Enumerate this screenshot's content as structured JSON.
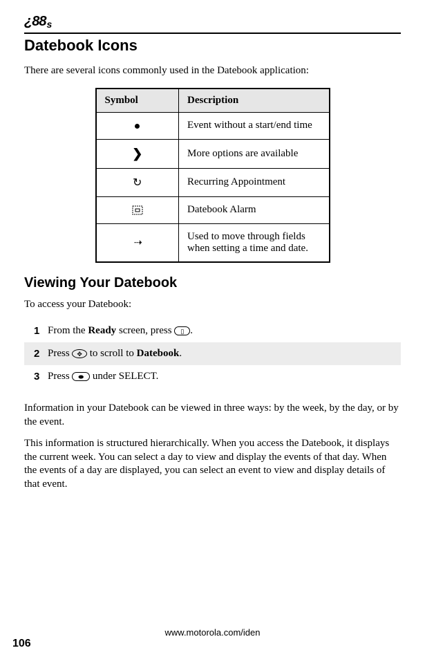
{
  "brand": "¿88",
  "brand_suffix": "s",
  "h1": "Datebook Icons",
  "intro": "There are several icons commonly used in the Datebook application:",
  "table": {
    "header_symbol": "Symbol",
    "header_desc": "Description",
    "rows": [
      {
        "desc": "Event without a start/end time"
      },
      {
        "desc": "More options are available"
      },
      {
        "desc": "Recurring Appointment"
      },
      {
        "desc": "Datebook Alarm"
      },
      {
        "desc": "Used to move through fields when setting a time and date."
      }
    ]
  },
  "h2": "Viewing Your Datebook",
  "p_access": "To access your Datebook:",
  "steps": [
    {
      "n": "1",
      "pre": "From the ",
      "bold1": "Ready",
      "mid": " screen, press ",
      "icon": "menu",
      "post": "."
    },
    {
      "n": "2",
      "pre": "Press ",
      "icon": "nav",
      "mid": " to scroll to ",
      "bold2": "Datebook",
      "post": "."
    },
    {
      "n": "3",
      "pre": "Press ",
      "icon": "select",
      "mid": " under SELECT.",
      "post": ""
    }
  ],
  "p_info1": "Information in your Datebook can be viewed in three ways: by the week, by the day, or by the event.",
  "p_info2": "This information is structured hierarchically. When you access the Datebook, it displays the current week. You can select a day to view and display the events of that day. When the events of a day are displayed, you can select an event to view and display details of that event.",
  "footer_url": "www.motorola.com/iden",
  "page_number": "106"
}
